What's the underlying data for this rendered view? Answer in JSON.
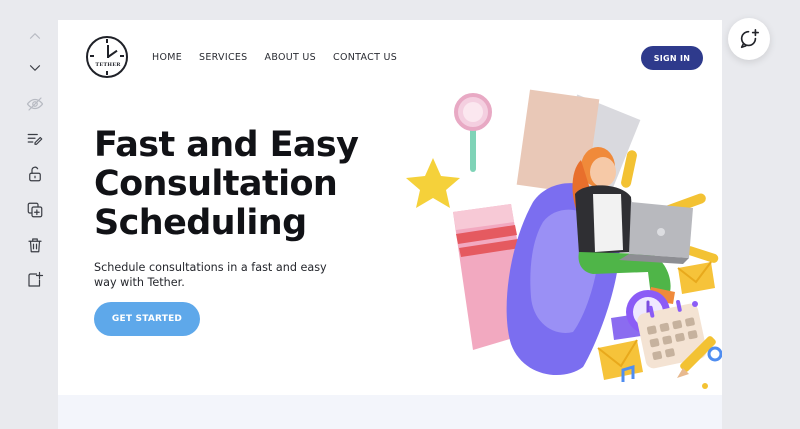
{
  "toolbar": {
    "items": [
      {
        "name": "move-up",
        "icon": "chevron-up-icon",
        "enabled": false
      },
      {
        "name": "move-down",
        "icon": "chevron-down-icon",
        "enabled": true
      },
      {
        "name": "visibility",
        "icon": "eye-slash-icon",
        "enabled": false
      },
      {
        "name": "edit",
        "icon": "edit-lines-icon",
        "enabled": true
      },
      {
        "name": "lock",
        "icon": "unlock-icon",
        "enabled": true
      },
      {
        "name": "duplicate",
        "icon": "duplicate-icon",
        "enabled": true
      },
      {
        "name": "delete",
        "icon": "trash-icon",
        "enabled": true
      },
      {
        "name": "add-section",
        "icon": "add-section-icon",
        "enabled": true
      }
    ]
  },
  "header": {
    "logo_text": "TETHER",
    "nav": [
      "HOME",
      "SERVICES",
      "ABOUT US",
      "CONTACT US"
    ],
    "signin_label": "SIGN IN"
  },
  "hero": {
    "title_lines": [
      "Fast and Easy",
      "Consultation",
      "Scheduling"
    ],
    "subtitle": "Schedule consultations in a fast and easy way with Tether.",
    "cta_label": "GET STARTED"
  },
  "comment_button": {
    "icon": "add-comment-icon"
  },
  "colors": {
    "signin_bg": "#2e3a8c",
    "cta_bg": "#5ea8ea",
    "canvas_bg": "#ffffff",
    "page_bg": "#e9eaee"
  }
}
